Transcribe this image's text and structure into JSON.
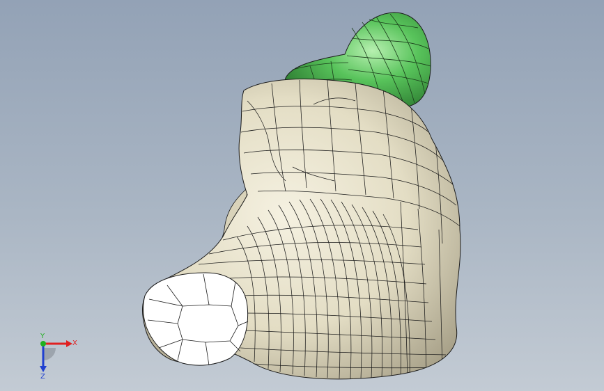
{
  "viewport": {
    "background_top": "#93a2b6",
    "background_bottom": "#c3cbd4"
  },
  "model": {
    "main_body_color": "#ece6cf",
    "main_body_shadow": "#a39d86",
    "mesh_line_color": "#1a1a1a",
    "top_part_color": "#4fbe55",
    "top_part_shadow": "#2f7f35"
  },
  "triad": {
    "x_label": "X",
    "y_label": "Y",
    "z_label": "Z",
    "x_color": "#e02020",
    "y_color": "#20b020",
    "z_color": "#2040d0"
  }
}
